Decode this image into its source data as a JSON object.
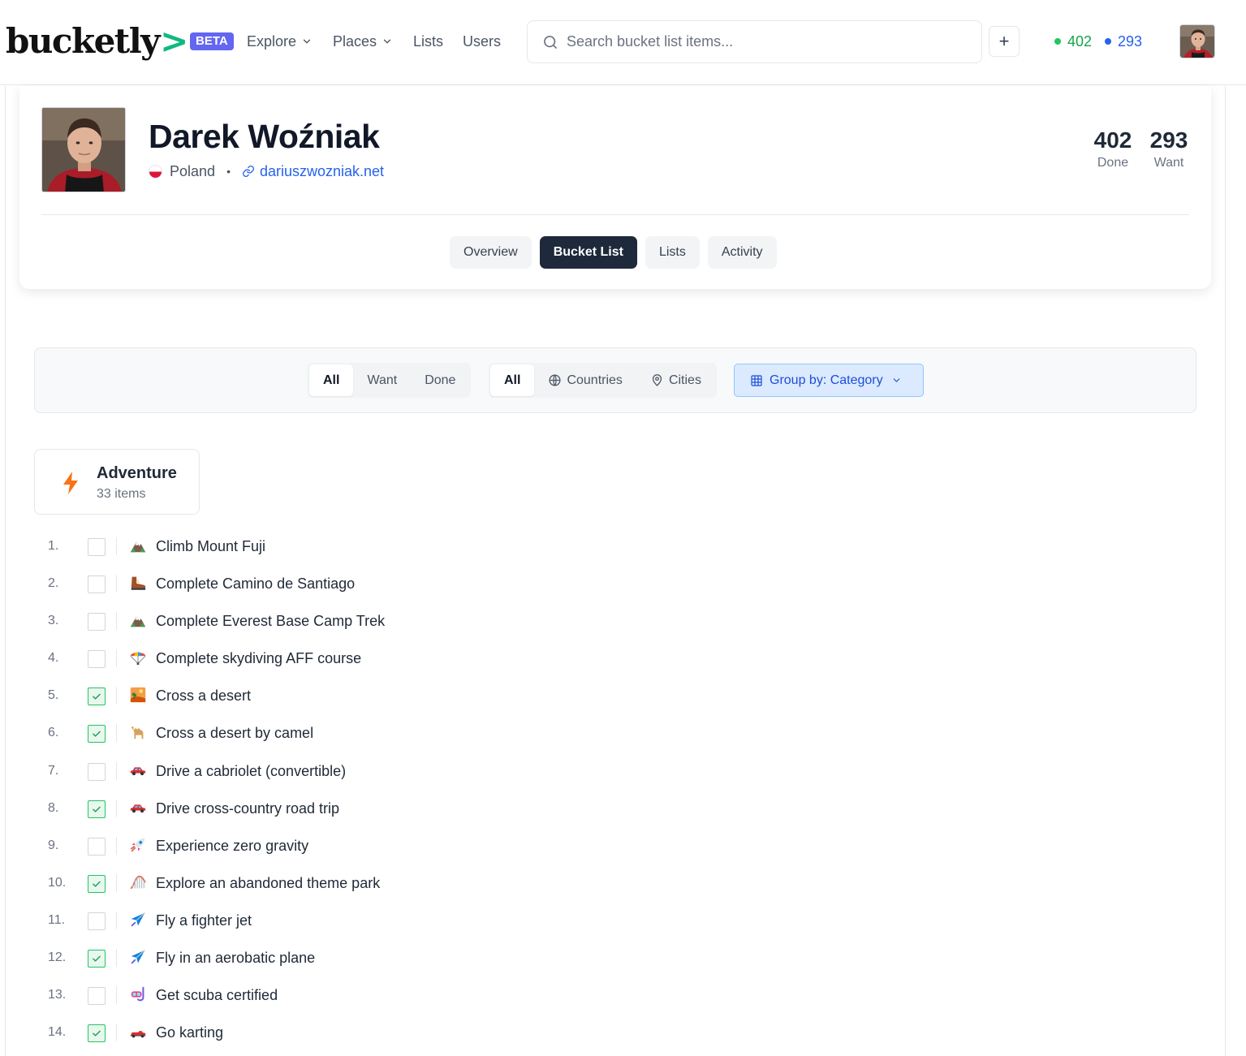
{
  "brand": {
    "logo": "bucketly",
    "logo_mark": ">",
    "beta": "BETA"
  },
  "nav": {
    "explore": "Explore",
    "places": "Places",
    "lists": "Lists",
    "users": "Users"
  },
  "search": {
    "placeholder": "Search bucket list items...",
    "value": ""
  },
  "header_counts": {
    "done": "402",
    "want": "293",
    "done_color": "#22c55e",
    "want_color": "#2563eb"
  },
  "profile": {
    "name": "Darek Woźniak",
    "country": "Poland",
    "website": "dariuszwozniak.net",
    "stats": {
      "done": "402",
      "done_label": "Done",
      "want": "293",
      "want_label": "Want"
    }
  },
  "tabs": [
    "Overview",
    "Bucket List",
    "Lists",
    "Activity"
  ],
  "active_tab": "Bucket List",
  "filters": {
    "status": [
      "All",
      "Want",
      "Done"
    ],
    "status_selected": "All",
    "scope": [
      "All",
      "Countries",
      "Cities"
    ],
    "scope_selected": "All",
    "scope_icons": [
      "",
      "globe-icon",
      "map-pin-icon"
    ],
    "group_by": "Group by: Category"
  },
  "category": {
    "name": "Adventure",
    "count": "33 items",
    "icon": "bolt-icon",
    "icon_color": "#f97316"
  },
  "items": [
    {
      "num": "1.",
      "title": "Climb Mount Fuji",
      "done": false,
      "icon": "mountain-icon"
    },
    {
      "num": "2.",
      "title": "Complete Camino de Santiago",
      "done": false,
      "icon": "hiking-boot-icon"
    },
    {
      "num": "3.",
      "title": "Complete Everest Base Camp Trek",
      "done": false,
      "icon": "mountain-icon"
    },
    {
      "num": "4.",
      "title": "Complete skydiving AFF course",
      "done": false,
      "icon": "parachute-icon"
    },
    {
      "num": "5.",
      "title": "Cross a desert",
      "done": true,
      "icon": "desert-icon"
    },
    {
      "num": "6.",
      "title": "Cross a desert by camel",
      "done": true,
      "icon": "camel-icon"
    },
    {
      "num": "7.",
      "title": "Drive a cabriolet (convertible)",
      "done": false,
      "icon": "car-icon"
    },
    {
      "num": "8.",
      "title": "Drive cross-country road trip",
      "done": true,
      "icon": "car-icon"
    },
    {
      "num": "9.",
      "title": "Experience zero gravity",
      "done": false,
      "icon": "rocket-icon"
    },
    {
      "num": "10.",
      "title": "Explore an abandoned theme park",
      "done": true,
      "icon": "roller-coaster-icon"
    },
    {
      "num": "11.",
      "title": "Fly a fighter jet",
      "done": false,
      "icon": "airplane-icon"
    },
    {
      "num": "12.",
      "title": "Fly in an aerobatic plane",
      "done": true,
      "icon": "airplane-icon"
    },
    {
      "num": "13.",
      "title": "Get scuba certified",
      "done": false,
      "icon": "diving-mask-icon"
    },
    {
      "num": "14.",
      "title": "Go karting",
      "done": true,
      "icon": "race-car-icon"
    }
  ]
}
